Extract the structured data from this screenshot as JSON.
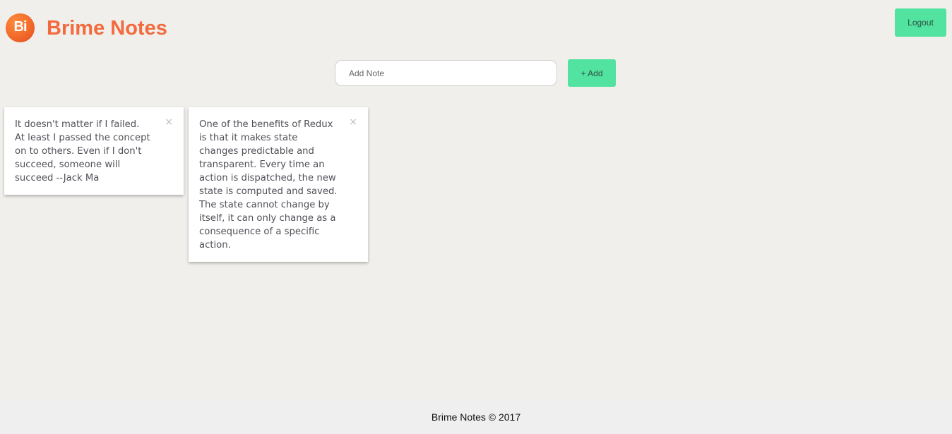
{
  "header": {
    "logo_text": "Bi",
    "title": "Brime Notes",
    "logout_label": "Logout"
  },
  "composer": {
    "input_placeholder": "Add Note",
    "input_value": "",
    "add_label": "+ Add"
  },
  "notes": [
    {
      "text": "It doesn't matter if I failed.\nAt least I passed the concept\non to others. Even if I don't\nsucceed, someone will\nsucceed --Jack Ma",
      "close_label": "×"
    },
    {
      "text": "One of the benefits of Redux\nis that it makes state\nchanges predictable and\ntransparent. Every time an\naction is dispatched, the new\nstate is computed and saved.\nThe state cannot change by\nitself, it can only change as a\nconsequence of a specific\naction.",
      "close_label": "×"
    }
  ],
  "footer": {
    "text": "Brime Notes © 2017"
  },
  "colors": {
    "brand": "#f26a3d",
    "accent": "#52e3a0",
    "background": "#f0efeb"
  },
  "icons": {
    "close": "close-icon",
    "logo": "brand-logo-icon"
  }
}
